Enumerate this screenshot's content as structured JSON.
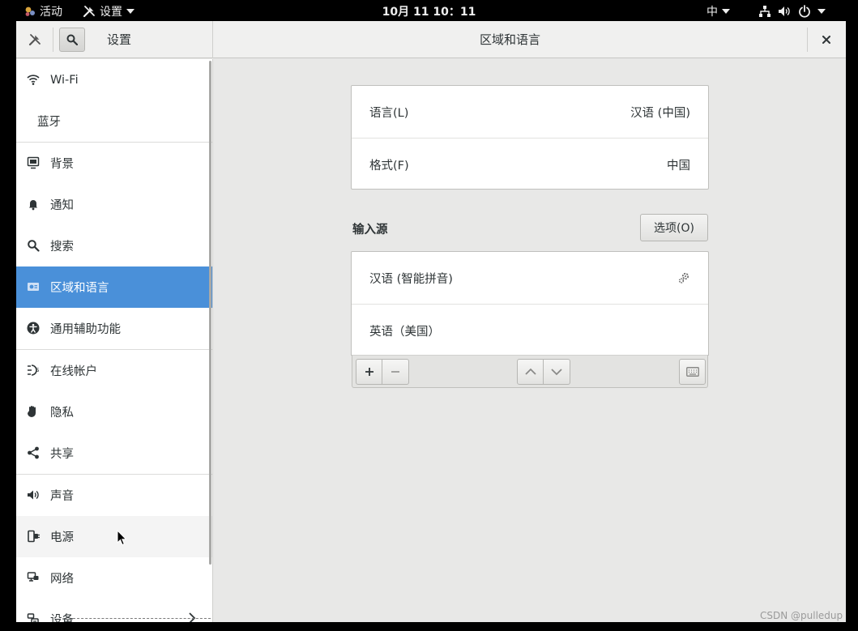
{
  "topbar": {
    "activities": "活动",
    "app_menu": "设置",
    "clock": "10月 11  10：11",
    "input_method": "中"
  },
  "headerbar": {
    "left_title": "设置",
    "main_title": "区域和语言"
  },
  "sidebar": {
    "items": [
      {
        "label": "Wi-Fi",
        "icon": "wifi-icon"
      },
      {
        "label": "蓝牙",
        "icon": ""
      },
      {
        "label": "背景",
        "icon": "background-icon"
      },
      {
        "label": "通知",
        "icon": "bell-icon"
      },
      {
        "label": "搜索",
        "icon": "search-icon"
      },
      {
        "label": "区域和语言",
        "icon": "flag-icon"
      },
      {
        "label": "通用辅助功能",
        "icon": "accessibility-icon"
      },
      {
        "label": "在线帐户",
        "icon": "online-accounts-icon"
      },
      {
        "label": "隐私",
        "icon": "hand-icon"
      },
      {
        "label": "共享",
        "icon": "share-icon"
      },
      {
        "label": "声音",
        "icon": "speaker-icon"
      },
      {
        "label": "电源",
        "icon": "power-plug-icon"
      },
      {
        "label": "网络",
        "icon": "network-icon"
      },
      {
        "label": "设备",
        "icon": "devices-icon"
      }
    ],
    "selected": "区域和语言"
  },
  "language_card": {
    "language_label": "语言(L)",
    "language_value": "汉语 (中国)",
    "formats_label": "格式(F)",
    "formats_value": "中国"
  },
  "input_sources": {
    "title": "输入源",
    "options_label": "选项(O)",
    "items": [
      {
        "label": "汉语 (智能拼音)"
      },
      {
        "label": "英语（美国）"
      }
    ]
  },
  "watermark": "CSDN @pulledup",
  "colors": {
    "accent": "#4a90d9",
    "background": "#e8e8e7",
    "topbar": "#000000"
  }
}
